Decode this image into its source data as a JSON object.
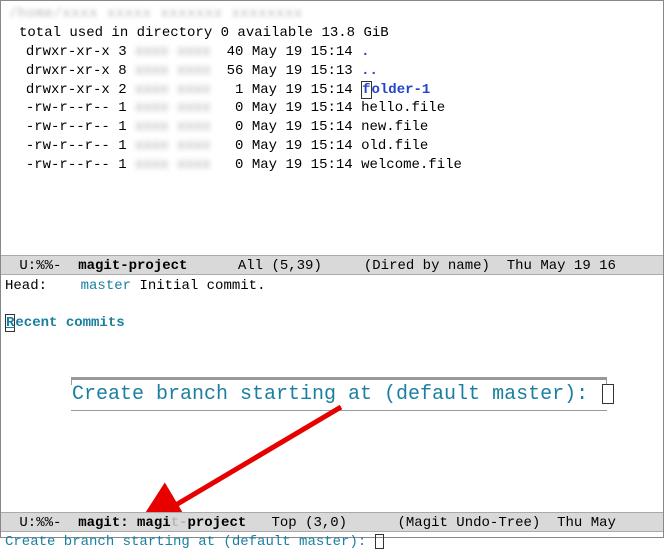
{
  "dired": {
    "header_obscured": "/home/xxxx xxxxx xxxxxxx xxxxxxxx",
    "total_line": "total used in directory 0 available 13.8 GiB",
    "entries": [
      {
        "perm": "drwxr-xr-x 3",
        "size": "40",
        "date": "May 19 15:14",
        "name": ".",
        "type": "dot"
      },
      {
        "perm": "drwxr-xr-x 8",
        "size": "56",
        "date": "May 19 15:13",
        "name": "..",
        "type": "dot"
      },
      {
        "perm": "drwxr-xr-x 2",
        "size": "1",
        "date": "May 19 15:14",
        "name": "folder-1",
        "type": "dir-cursor"
      },
      {
        "perm": "-rw-r--r-- 1",
        "size": "0",
        "date": "May 19 15:14",
        "name": "hello.file",
        "type": "file"
      },
      {
        "perm": "-rw-r--r-- 1",
        "size": "0",
        "date": "May 19 15:14",
        "name": "new.file",
        "type": "file"
      },
      {
        "perm": "-rw-r--r-- 1",
        "size": "0",
        "date": "May 19 15:14",
        "name": "old.file",
        "type": "file"
      },
      {
        "perm": "-rw-r--r-- 1",
        "size": "0",
        "date": "May 19 15:14",
        "name": "welcome.file",
        "type": "file"
      }
    ]
  },
  "modeline1": {
    "left": " U:%%-  ",
    "buffer": "magit-project",
    "pos": "      All (5,39)     ",
    "mode": "(Dired by name)",
    "time": "  Thu May 19 16"
  },
  "magit": {
    "head_label": "Head:    ",
    "head_branch": "master",
    "head_msg": " Initial commit.",
    "recent_first": "R",
    "recent_rest": "ecent commits"
  },
  "center_prompt": {
    "text": "Create branch starting at (default master): "
  },
  "modeline2": {
    "left": " U:%%-  ",
    "buffer": "magit: magit-project",
    "buffer_a": "magit: magi",
    "buffer_b": "t-",
    "buffer_c": "project",
    "pos": "   Top (3,0)      ",
    "mode": "(Magit Undo-Tree)",
    "time": "  Thu May "
  },
  "minibuffer": {
    "text": "Create branch starting at (default master): "
  }
}
